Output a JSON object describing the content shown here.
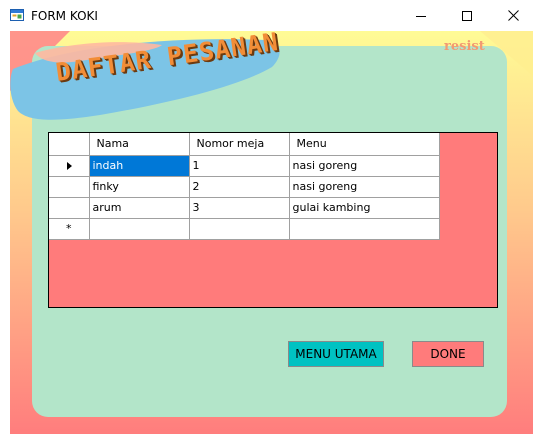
{
  "window": {
    "title": "FORM KOKI",
    "controls": [
      "minimize-icon",
      "maximize-icon",
      "close-icon"
    ]
  },
  "header": {
    "title": "DAFTAR PESANAN",
    "brand": "resist"
  },
  "grid": {
    "columns": [
      "Nama",
      "Nomor meja",
      "Menu"
    ],
    "rows": [
      [
        "indah",
        "1",
        "nasi goreng"
      ],
      [
        "finky",
        "2",
        "nasi goreng"
      ],
      [
        "arum",
        "3",
        "gulai kambing"
      ]
    ],
    "new_row_marker": "*",
    "selected_cell": "indah"
  },
  "buttons": {
    "menu_utama": "MENU UTAMA",
    "done": "DONE"
  },
  "colors": {
    "background_top": "#fffb95",
    "background_bottom": "#ff7d7d",
    "panel": "#b3e5c9",
    "banner": "#7cc4e6",
    "title_text": "#f28d37",
    "grid_background": "#ff7b7b",
    "selection": "#0078d7",
    "menu_button": "#00c2c2",
    "done_button": "#ff7b7b"
  }
}
